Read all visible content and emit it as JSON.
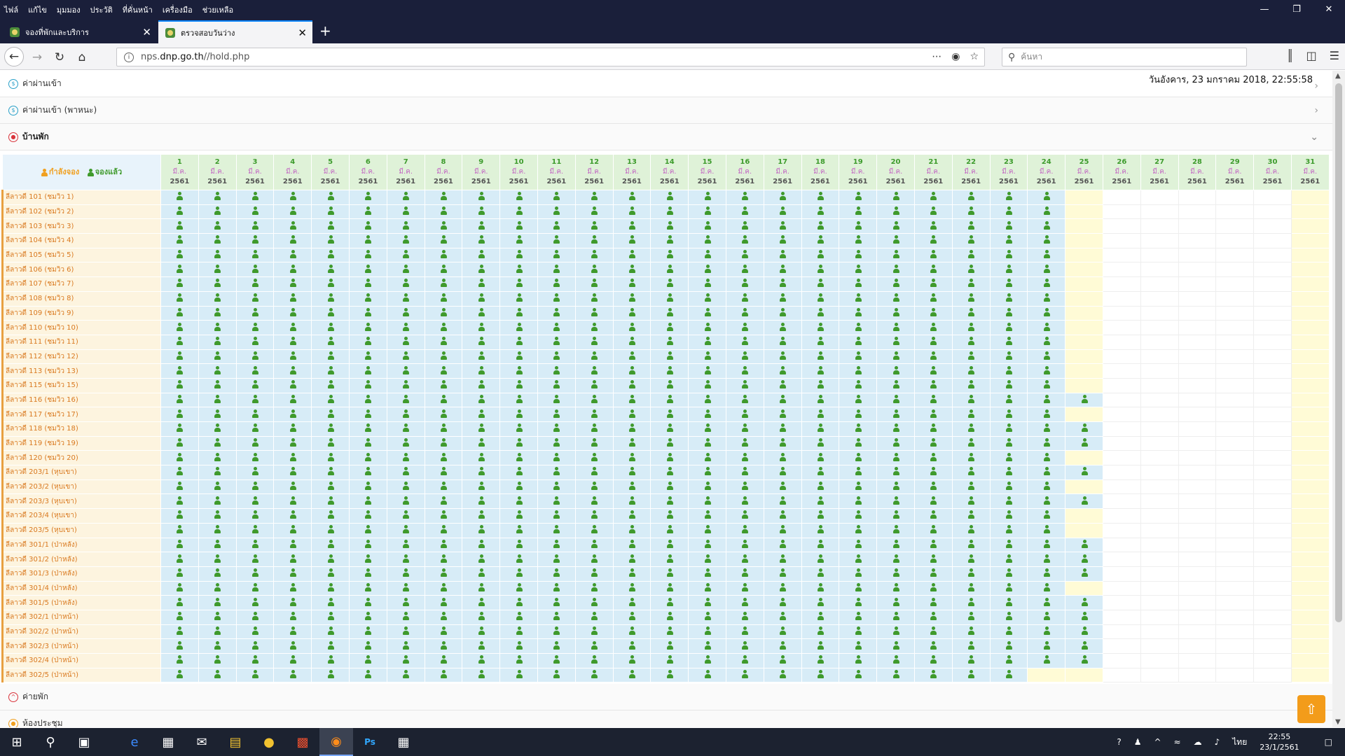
{
  "menu": [
    "ไฟล์",
    "แก้ไข",
    "มุมมอง",
    "ประวัติ",
    "ที่คั่นหน้า",
    "เครื่องมือ",
    "ช่วยเหลือ"
  ],
  "tabs": [
    {
      "label": "จองที่พักและบริการ"
    },
    {
      "label": "ตรวจสอบวันว่าง"
    }
  ],
  "url": {
    "prefix": "nps.",
    "host": "dnp.go.th",
    "path": "//hold.php"
  },
  "search": {
    "placeholder": "ค้นหา"
  },
  "datetime": "วันอังคาร, 23 มกราคม 2018, 22:55:58",
  "sections": {
    "fee": "ค่าผ่านเข้า",
    "fee_vehicle": "ค่าผ่านเข้า (พาหนะ)",
    "house": "บ้านพัก",
    "camp": "ค่ายพัก",
    "meeting": "ห้องประชุม"
  },
  "legend": {
    "pending": "กำลังจอง",
    "booked": "จองแล้ว"
  },
  "colors": {
    "pending": "#f0a020",
    "booked": "#3f9a2c",
    "booked_cell": "#d7ecf7",
    "available_cell": "#fffbd6"
  },
  "days": [
    {
      "d": "1",
      "m": "มี.ค.",
      "y": "2561"
    },
    {
      "d": "2",
      "m": "มี.ค.",
      "y": "2561"
    },
    {
      "d": "3",
      "m": "มี.ค.",
      "y": "2561"
    },
    {
      "d": "4",
      "m": "มี.ค.",
      "y": "2561"
    },
    {
      "d": "5",
      "m": "มี.ค.",
      "y": "2561"
    },
    {
      "d": "6",
      "m": "มี.ค.",
      "y": "2561"
    },
    {
      "d": "7",
      "m": "มี.ค.",
      "y": "2561"
    },
    {
      "d": "8",
      "m": "มี.ค.",
      "y": "2561"
    },
    {
      "d": "9",
      "m": "มี.ค.",
      "y": "2561"
    },
    {
      "d": "10",
      "m": "มี.ค.",
      "y": "2561"
    },
    {
      "d": "11",
      "m": "มี.ค.",
      "y": "2561"
    },
    {
      "d": "12",
      "m": "มี.ค.",
      "y": "2561"
    },
    {
      "d": "13",
      "m": "มี.ค.",
      "y": "2561"
    },
    {
      "d": "14",
      "m": "มี.ค.",
      "y": "2561"
    },
    {
      "d": "15",
      "m": "มี.ค.",
      "y": "2561"
    },
    {
      "d": "16",
      "m": "มี.ค.",
      "y": "2561"
    },
    {
      "d": "17",
      "m": "มี.ค.",
      "y": "2561"
    },
    {
      "d": "18",
      "m": "มี.ค.",
      "y": "2561"
    },
    {
      "d": "19",
      "m": "มี.ค.",
      "y": "2561"
    },
    {
      "d": "20",
      "m": "มี.ค.",
      "y": "2561"
    },
    {
      "d": "21",
      "m": "มี.ค.",
      "y": "2561"
    },
    {
      "d": "22",
      "m": "มี.ค.",
      "y": "2561"
    },
    {
      "d": "23",
      "m": "มี.ค.",
      "y": "2561"
    },
    {
      "d": "24",
      "m": "มี.ค.",
      "y": "2561"
    },
    {
      "d": "25",
      "m": "มี.ค.",
      "y": "2561"
    },
    {
      "d": "26",
      "m": "มี.ค.",
      "y": "2561"
    },
    {
      "d": "27",
      "m": "มี.ค.",
      "y": "2561"
    },
    {
      "d": "28",
      "m": "มี.ค.",
      "y": "2561"
    },
    {
      "d": "29",
      "m": "มี.ค.",
      "y": "2561"
    },
    {
      "d": "30",
      "m": "มี.ค.",
      "y": "2561"
    },
    {
      "d": "31",
      "m": "มี.ค.",
      "y": "2561"
    }
  ],
  "rooms": [
    {
      "name": "ลีลาวดี 101 (ชมวิว 1)",
      "day25": "A"
    },
    {
      "name": "ลีลาวดี 102 (ชมวิว 2)",
      "day25": "A"
    },
    {
      "name": "ลีลาวดี 103 (ชมวิว 3)",
      "day25": "A"
    },
    {
      "name": "ลีลาวดี 104 (ชมวิว 4)",
      "day25": "A"
    },
    {
      "name": "ลีลาวดี 105 (ชมวิว 5)",
      "day25": "A"
    },
    {
      "name": "ลีลาวดี 106 (ชมวิว 6)",
      "day25": "A"
    },
    {
      "name": "ลีลาวดี 107 (ชมวิว 7)",
      "day25": "A"
    },
    {
      "name": "ลีลาวดี 108 (ชมวิว 8)",
      "day25": "A"
    },
    {
      "name": "ลีลาวดี 109 (ชมวิว 9)",
      "day25": "A"
    },
    {
      "name": "ลีลาวดี 110 (ชมวิว 10)",
      "day25": "A"
    },
    {
      "name": "ลีลาวดี 111 (ชมวิว 11)",
      "day25": "A"
    },
    {
      "name": "ลีลาวดี 112 (ชมวิว 12)",
      "day25": "A"
    },
    {
      "name": "ลีลาวดี 113 (ชมวิว 13)",
      "day25": "A"
    },
    {
      "name": "ลีลาวดี 115 (ชมวิว 15)",
      "day25": "A"
    },
    {
      "name": "ลีลาวดี 116 (ชมวิว 16)",
      "day25": "B"
    },
    {
      "name": "ลีลาวดี 117 (ชมวิว 17)",
      "day25": "A"
    },
    {
      "name": "ลีลาวดี 118 (ชมวิว 18)",
      "day25": "B"
    },
    {
      "name": "ลีลาวดี 119 (ชมวิว 19)",
      "day25": "B"
    },
    {
      "name": "ลีลาวดี 120 (ชมวิว 20)",
      "day25": "A"
    },
    {
      "name": "ลีลาวดี 203/1 (หุบเขา)",
      "day25": "B"
    },
    {
      "name": "ลีลาวดี 203/2 (หุบเขา)",
      "day25": "A"
    },
    {
      "name": "ลีลาวดี 203/3 (หุบเขา)",
      "day25": "B"
    },
    {
      "name": "ลีลาวดี 203/4 (หุบเขา)",
      "day25": "A"
    },
    {
      "name": "ลีลาวดี 203/5 (หุบเขา)",
      "day25": "A"
    },
    {
      "name": "ลีลาวดี 301/1 (ป่าหลัง)",
      "day25": "B"
    },
    {
      "name": "ลีลาวดี 301/2 (ป่าหลัง)",
      "day25": "B"
    },
    {
      "name": "ลีลาวดี 301/3 (ป่าหลัง)",
      "day25": "B"
    },
    {
      "name": "ลีลาวดี 301/4 (ป่าหลัง)",
      "day25": "A"
    },
    {
      "name": "ลีลาวดี 301/5 (ป่าหลัง)",
      "day25": "B"
    },
    {
      "name": "ลีลาวดี 302/1 (ป่าหน้า)",
      "day25": "B"
    },
    {
      "name": "ลีลาวดี 302/2 (ป่าหน้า)",
      "day25": "B"
    },
    {
      "name": "ลีลาวดี 302/3 (ป่าหน้า)",
      "day25": "B"
    },
    {
      "name": "ลีลาวดี 302/4 (ป่าหน้า)",
      "day25": "B"
    },
    {
      "name": "ลีลาวดี 302/5 (ป่าหน้า)",
      "day25": "A",
      "day24": "A"
    }
  ],
  "taskbar": {
    "lang": "ไทย",
    "time": "22:55",
    "date": "23/1/2561"
  }
}
